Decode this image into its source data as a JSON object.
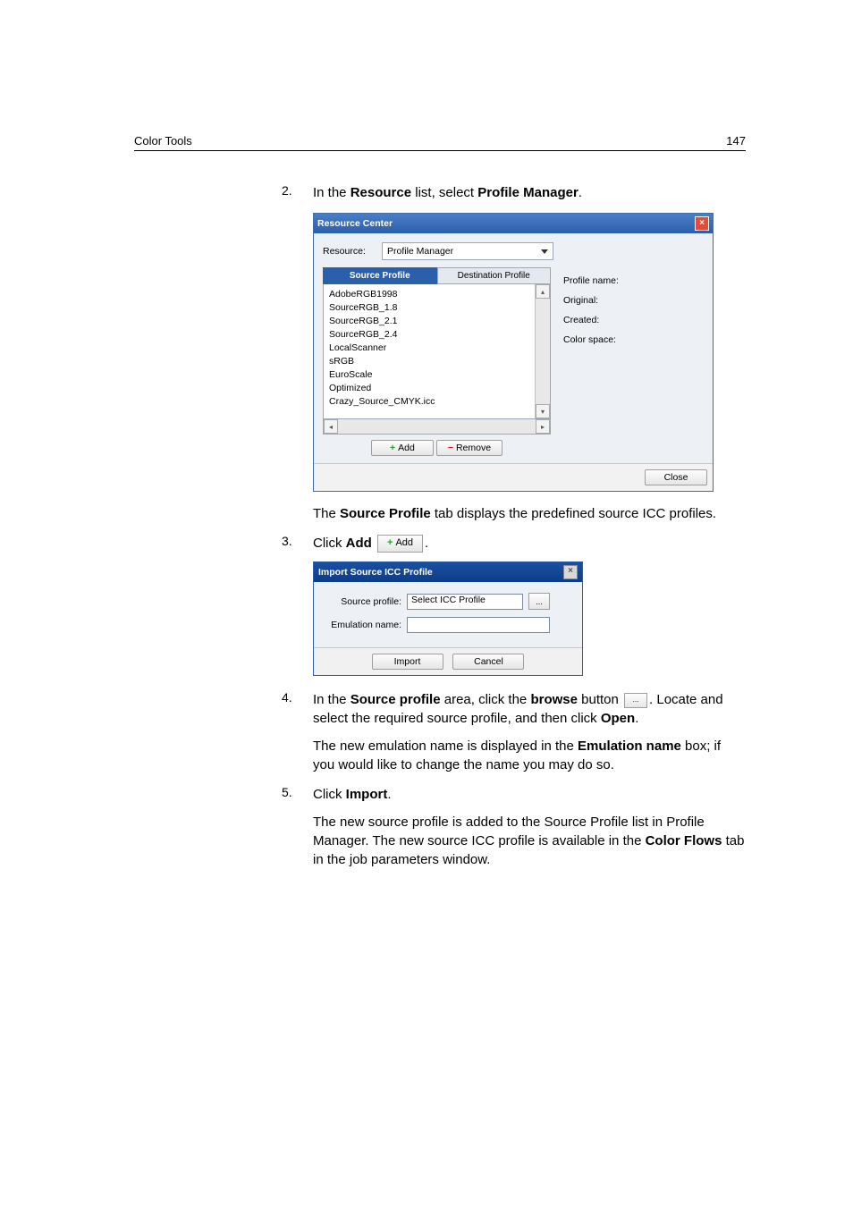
{
  "header": {
    "chapter": "Color Tools",
    "page": "147"
  },
  "steps": {
    "s2": {
      "num": "2.",
      "text_a": "In the ",
      "text_b": "Resource",
      "text_c": " list, select ",
      "text_d": "Profile Manager",
      "text_e": ".",
      "after_a": "The ",
      "after_b": "Source Profile",
      "after_c": " tab displays the predefined source ICC profiles."
    },
    "s3": {
      "num": "3.",
      "text_a": "Click ",
      "text_b": "Add",
      "inline_add": "Add",
      "text_c": "."
    },
    "s4": {
      "num": "4.",
      "t1": "In the ",
      "t2": "Source profile",
      "t3": " area, click the ",
      "t4": "browse",
      "t5": " button ",
      "t6": ". Locate and select the required source profile, and then click ",
      "t7": "Open",
      "t8": ".",
      "p2a": "The new emulation name is displayed in the ",
      "p2b": "Emulation name",
      "p2c": " box; if you would like to change the name you may do so."
    },
    "s5": {
      "num": "5.",
      "t1": "Click ",
      "t2": "Import",
      "t3": ".",
      "p2": "The new source profile is added to the Source Profile list in Profile Manager. The new source ICC profile is available in the ",
      "p2b": "Color Flows",
      "p2c": " tab in the job parameters window."
    }
  },
  "rc": {
    "title": "Resource Center",
    "resource_label": "Resource:",
    "resource_value": "Profile Manager",
    "tab_source": "Source Profile",
    "tab_dest": "Destination Profile",
    "profiles": [
      "AdobeRGB1998",
      "SourceRGB_1.8",
      "SourceRGB_2.1",
      "SourceRGB_2.4",
      "LocalScanner",
      "sRGB",
      "EuroScale",
      "Optimized",
      "Crazy_Source_CMYK.icc"
    ],
    "add": "Add",
    "remove": "Remove",
    "meta_profile": "Profile name:",
    "meta_original": "Original:",
    "meta_created": "Created:",
    "meta_space": "Color space:",
    "close": "Close"
  },
  "imp": {
    "title": "Import Source ICC Profile",
    "lbl_source": "Source profile:",
    "val_source": "Select ICC Profile",
    "lbl_emul": "Emulation name:",
    "browse_dots": "...",
    "import": "Import",
    "cancel": "Cancel"
  }
}
